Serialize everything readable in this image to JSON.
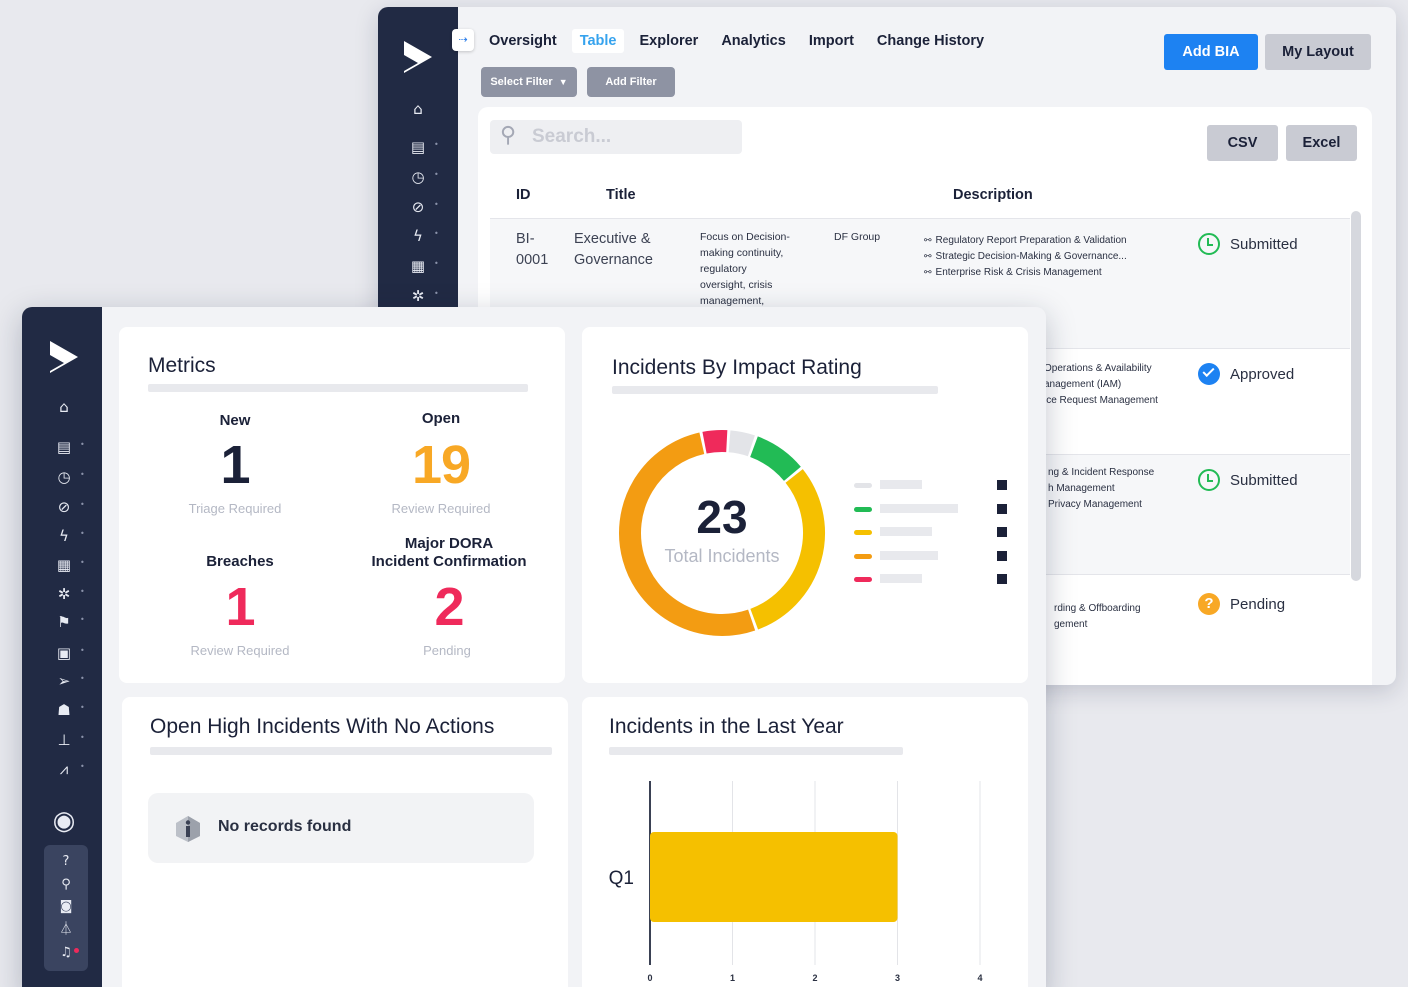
{
  "colors": {
    "sidebar": "#212a44",
    "primary": "#1d82f2",
    "orange": "#f39c12",
    "red": "#ef2a5b",
    "green": "#22bb55",
    "yellow": "#f5c000",
    "grey": "#e3e4e8"
  },
  "back_window": {
    "sidebar_icons": [
      "home-icon",
      "book-icon",
      "clock-icon",
      "compass-icon",
      "bolt-icon",
      "file-icon",
      "gear-cluster-icon"
    ],
    "tabs": [
      {
        "label": "Oversight",
        "active": false
      },
      {
        "label": "Table",
        "active": true
      },
      {
        "label": "Explorer",
        "active": false
      },
      {
        "label": "Analytics",
        "active": false
      },
      {
        "label": "Import",
        "active": false
      },
      {
        "label": "Change History",
        "active": false
      }
    ],
    "add_button": "Add BIA",
    "layout_button": "My Layout",
    "select_filter": "Select Filter",
    "add_filter": "Add Filter",
    "search_placeholder": "Search...",
    "csv_button": "CSV",
    "excel_button": "Excel",
    "columns": {
      "id": "ID",
      "title": "Title",
      "description": "Description"
    },
    "rows": [
      {
        "id": "BI-\n0001",
        "title": "Executive &\nGovernance",
        "summary": "Focus on Decision-\nmaking continuity,\nregulatory\noversight, crisis\nmanagement,",
        "group": "DF Group",
        "links": [
          "Regulatory Report Preparation & Validation",
          "Strategic Decision-Making & Governance...",
          "Enterprise Risk & Crisis Management"
        ],
        "status": "Submitted",
        "status_type": "clock-green"
      },
      {
        "links": [
          "Operations & Availability",
          "anagement (IAM)",
          "ice Request Management"
        ],
        "status": "Approved",
        "status_type": "check-blue"
      },
      {
        "links": [
          "ng & Incident Response",
          "h Management",
          "Privacy Management"
        ],
        "status": "Submitted",
        "status_type": "clock-green"
      },
      {
        "links": [
          "rding & Offboarding",
          "gement"
        ],
        "status": "Pending",
        "status_type": "question-orange"
      }
    ]
  },
  "front_window": {
    "sidebar_icons": [
      "home-icon",
      "book-icon",
      "clock-icon",
      "compass-icon",
      "bolt-icon",
      "file-icon",
      "gear-cluster-icon",
      "flag-icon",
      "calendar-icon",
      "send-icon",
      "users-icon",
      "hierarchy-icon",
      "chart-icon"
    ],
    "sidebar_bottom_icons": [
      "help-icon",
      "search-icon",
      "camera-icon",
      "flask-icon",
      "bell-icon"
    ],
    "metrics": {
      "title": "Metrics",
      "items": [
        {
          "label": "New",
          "value": "1",
          "sub": "Triage Required",
          "color": "#1b2138"
        },
        {
          "label": "Open",
          "value": "19",
          "sub": "Review Required",
          "color": "#f8a825"
        },
        {
          "label": "Breaches",
          "value": "1",
          "sub": "Review Required",
          "color": "#ef2a5b"
        },
        {
          "label": "Major DORA\nIncident Confirmation",
          "value": "2",
          "sub": "Pending",
          "color": "#ef2a5b"
        }
      ]
    },
    "impact": {
      "title": "Incidents By Impact Rating",
      "total": "23",
      "total_label": "Total Incidents"
    },
    "open_high": {
      "title": "Open High Incidents With No Actions",
      "empty_text": "No records found"
    },
    "last_year": {
      "title": "Incidents in the Last Year"
    }
  },
  "chart_data": [
    {
      "type": "pie",
      "title": "Incidents By Impact Rating",
      "total": 23,
      "series": [
        {
          "color": "#ef2a5b",
          "value": 1
        },
        {
          "color": "#e3e4e8",
          "value": 1
        },
        {
          "color": "#22bb55",
          "value": 2
        },
        {
          "color": "#f5c000",
          "value": 7
        },
        {
          "color": "#f39c12",
          "value": 12
        }
      ],
      "legend_placement": "right"
    },
    {
      "type": "bar",
      "orientation": "horizontal",
      "title": "Incidents in the Last Year",
      "categories": [
        "Q1"
      ],
      "values": [
        3
      ],
      "xlim": [
        0,
        4
      ],
      "xticks": [
        "0",
        "1",
        "2",
        "3",
        "4"
      ],
      "bar_color": "#f5c000",
      "grid": true
    }
  ]
}
